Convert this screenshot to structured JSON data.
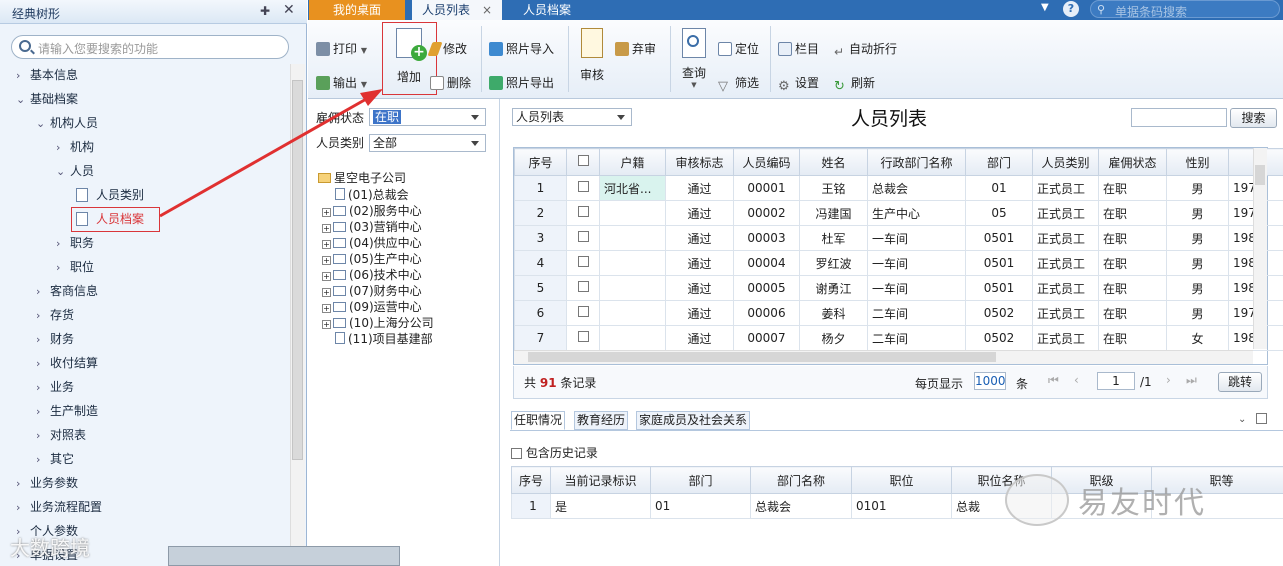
{
  "left_panel": {
    "title": "经典树形",
    "search_placeholder": "请输入您要搜索的功能",
    "tree": [
      {
        "label": "基本信息",
        "arrow": "›"
      },
      {
        "label": "基础档案",
        "arrow": "⌄"
      },
      {
        "label": "机构人员",
        "arrow": "⌄"
      },
      {
        "label": "机构",
        "arrow": "›"
      },
      {
        "label": "人员",
        "arrow": "⌄"
      },
      {
        "label": "人员类别",
        "arrow": ""
      },
      {
        "label": "人员档案",
        "arrow": ""
      },
      {
        "label": "职务",
        "arrow": "›"
      },
      {
        "label": "职位",
        "arrow": "›"
      },
      {
        "label": "客商信息",
        "arrow": "›"
      },
      {
        "label": "存货",
        "arrow": "›"
      },
      {
        "label": "财务",
        "arrow": "›"
      },
      {
        "label": "收付结算",
        "arrow": "›"
      },
      {
        "label": "业务",
        "arrow": "›"
      },
      {
        "label": "生产制造",
        "arrow": "›"
      },
      {
        "label": "对照表",
        "arrow": "›"
      },
      {
        "label": "其它",
        "arrow": "›"
      },
      {
        "label": "业务参数",
        "arrow": "›"
      },
      {
        "label": "业务流程配置",
        "arrow": "›"
      },
      {
        "label": "个人参数",
        "arrow": "›"
      },
      {
        "label": "单据设置",
        "arrow": "›"
      }
    ]
  },
  "tabs": {
    "desk": "我的桌面",
    "list": "人员列表",
    "file": "人员档案",
    "close": "×"
  },
  "top_search_placeholder": "单据条码搜索",
  "ribbon": {
    "print": "打印",
    "export": "输出",
    "add": "增加",
    "edit": "修改",
    "delete": "删除",
    "photo_import": "照片导入",
    "photo_export": "照片导出",
    "audit": "审核",
    "abandon": "弃审",
    "query": "查询",
    "locate": "定位",
    "filter": "筛选",
    "columns": "栏目",
    "settings": "设置",
    "auto_wrap": "自动折行",
    "refresh": "刷新"
  },
  "filter": {
    "employ_label": "雇佣状态",
    "employ_value": "在职",
    "type_label": "人员类别",
    "type_value": "全部",
    "org_root": "星空电子公司",
    "orgs": [
      {
        "label": "(01)总裁会",
        "pm": ""
      },
      {
        "label": "(02)服务中心",
        "pm": "+"
      },
      {
        "label": "(03)营销中心",
        "pm": "+"
      },
      {
        "label": "(04)供应中心",
        "pm": "+"
      },
      {
        "label": "(05)生产中心",
        "pm": "+"
      },
      {
        "label": "(06)技术中心",
        "pm": "+"
      },
      {
        "label": "(07)财务中心",
        "pm": "+"
      },
      {
        "label": "(09)运营中心",
        "pm": "+"
      },
      {
        "label": "(10)上海分公司",
        "pm": "+"
      },
      {
        "label": "(11)项目基建部",
        "pm": ""
      }
    ]
  },
  "main": {
    "view_select": "人员列表",
    "title": "人员列表",
    "search_button": "搜索",
    "columns": [
      "序号",
      "",
      "户籍",
      "审核标志",
      "人员编码",
      "姓名",
      "行政部门名称",
      "部门",
      "人员类别",
      "雇佣状态",
      "性别",
      "出"
    ],
    "rows": [
      [
        "1",
        "",
        "河北省...",
        "通过",
        "00001",
        "王铭",
        "总裁会",
        "01",
        "正式员工",
        "在职",
        "男",
        "197"
      ],
      [
        "2",
        "",
        "",
        "通过",
        "00002",
        "冯建国",
        "生产中心",
        "05",
        "正式员工",
        "在职",
        "男",
        "197"
      ],
      [
        "3",
        "",
        "",
        "通过",
        "00003",
        "杜军",
        "一车间",
        "0501",
        "正式员工",
        "在职",
        "男",
        "198"
      ],
      [
        "4",
        "",
        "",
        "通过",
        "00004",
        "罗红波",
        "一车间",
        "0501",
        "正式员工",
        "在职",
        "男",
        "198"
      ],
      [
        "5",
        "",
        "",
        "通过",
        "00005",
        "谢勇江",
        "一车间",
        "0501",
        "正式员工",
        "在职",
        "男",
        "198"
      ],
      [
        "6",
        "",
        "",
        "通过",
        "00006",
        "姜科",
        "二车间",
        "0502",
        "正式员工",
        "在职",
        "男",
        "197"
      ],
      [
        "7",
        "",
        "",
        "通过",
        "00007",
        "杨夕",
        "二车间",
        "0502",
        "正式员工",
        "在职",
        "女",
        "198"
      ]
    ],
    "pager": {
      "total_prefix": "共",
      "total": "91",
      "total_suffix": "条记录",
      "per_page_label": "每页显示",
      "per_page": "1000",
      "per_page_unit": "条",
      "page": "1",
      "page_total": "/1",
      "jump": "跳转"
    },
    "sub_tabs": [
      "任职情况",
      "教育经历",
      "家庭成员及社会关系"
    ],
    "history_label": "包含历史记录",
    "sub_columns": [
      "序号",
      "当前记录标识",
      "部门",
      "部门名称",
      "职位",
      "职位名称",
      "职级",
      "职等"
    ],
    "sub_rows": [
      [
        "1",
        "是",
        "01",
        "总裁会",
        "0101",
        "总裁",
        "",
        ""
      ]
    ]
  },
  "watermarks": {
    "top_right": "易友时代",
    "bottom_left": "大数跨境"
  },
  "colors": {
    "accent": "#2e6db4",
    "tab_active": "#e8911f",
    "highlight": "#d9363a"
  }
}
